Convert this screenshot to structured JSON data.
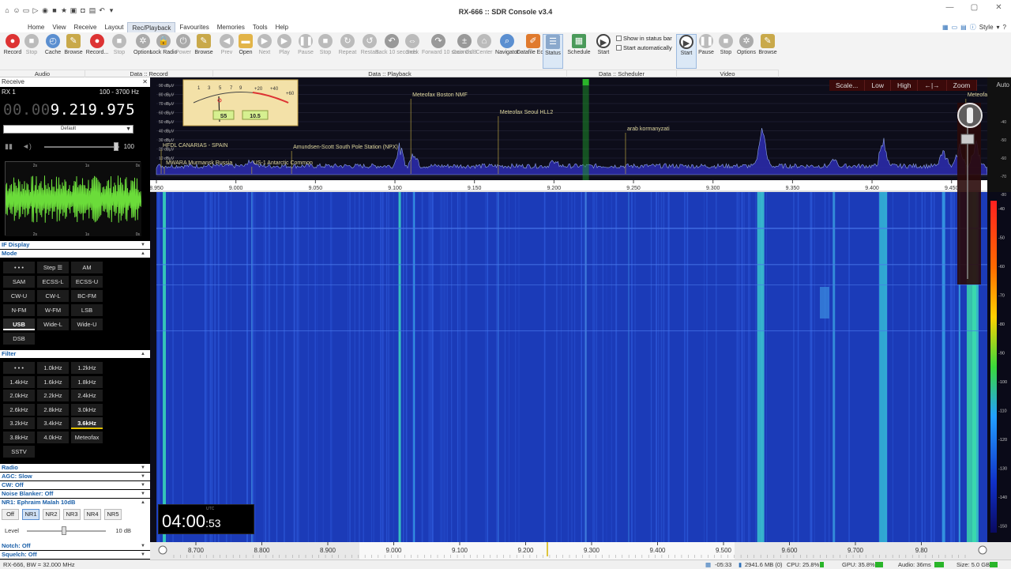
{
  "window": {
    "title": "RX-666 :: SDR Console v3.4"
  },
  "menu": {
    "items": [
      "Home",
      "View",
      "Receive",
      "Layout",
      "Rec/Playback",
      "Favourites",
      "Memories",
      "Tools",
      "Help"
    ],
    "active": "Rec/Playback",
    "style_label": "Style"
  },
  "ribbon": {
    "buttons": [
      {
        "label": "Record",
        "icon": "record-icon"
      },
      {
        "label": "Stop",
        "icon": "stop-icon"
      },
      {
        "label": "Cache",
        "icon": "cache-icon"
      },
      {
        "label": "Browse",
        "icon": "browse-icon"
      },
      {
        "label": "Record...",
        "icon": "record-icon"
      },
      {
        "label": "Stop",
        "icon": "stop-icon"
      },
      {
        "label": "Options",
        "icon": "gear-icon"
      },
      {
        "label": "Lock Radio",
        "icon": "lock-icon"
      },
      {
        "label": "Power",
        "icon": "power-icon"
      },
      {
        "label": "Browse",
        "icon": "browse-icon"
      },
      {
        "label": "Prev",
        "icon": "prev-icon"
      },
      {
        "label": "Open",
        "icon": "folder-icon"
      },
      {
        "label": "Next",
        "icon": "next-icon"
      },
      {
        "label": "Play",
        "icon": "play-icon"
      },
      {
        "label": "Pause",
        "icon": "pause-icon"
      },
      {
        "label": "Stop",
        "icon": "stop-icon"
      },
      {
        "label": "Repeat",
        "icon": "repeat-icon"
      },
      {
        "label": "Restart",
        "icon": "restart-icon"
      },
      {
        "label": "Back 10 seconds",
        "icon": "back-icon"
      },
      {
        "label": "Seek",
        "icon": "seek-icon"
      },
      {
        "label": "Forward 10 seconds",
        "icon": "forward-icon"
      },
      {
        "label": "Gain 0 dB",
        "icon": "gain-icon"
      },
      {
        "label": "Center",
        "icon": "center-icon"
      },
      {
        "label": "Navigator",
        "icon": "navigator-icon"
      },
      {
        "label": "Datafile Editor",
        "icon": "editor-icon"
      },
      {
        "label": "Status",
        "icon": "status-icon"
      },
      {
        "label": "Schedule",
        "icon": "schedule-icon"
      },
      {
        "label": "Start",
        "icon": "start-icon"
      },
      {
        "label": "Start",
        "icon": "start-icon"
      },
      {
        "label": "Pause",
        "icon": "pause-icon"
      },
      {
        "label": "Stop",
        "icon": "stop-icon"
      },
      {
        "label": "Options",
        "icon": "gear-icon"
      },
      {
        "label": "Browse",
        "icon": "browse-icon"
      }
    ],
    "groups": [
      "Audio",
      "Data :: Record",
      "Data :: Playback",
      "Data :: Scheduler",
      "Video"
    ],
    "show_in_status_bar": "Show in status bar",
    "start_automatically": "Start automatically"
  },
  "receive_panel": {
    "header": "Receive",
    "rx": "RX 1",
    "range": "100 - 3700 Hz",
    "freq_dim": "00.00",
    "freq_main": "9.219.975",
    "dropdown": "Default",
    "volume": "100",
    "sections": {
      "if_display": "IF Display",
      "mode": "Mode",
      "filter": "Filter",
      "radio": "Radio",
      "agc": "AGC: Slow",
      "cw": "CW: Off",
      "noise_blanker": "Noise Blanker: Off",
      "nr1": "NR1: Ephraim Malah 10dB",
      "level": "Level",
      "level_value": "10 dB",
      "notch": "Notch: Off",
      "squelch": "Squelch: Off"
    },
    "modes": [
      "• • •",
      "Step ☰",
      "AM",
      "SAM",
      "ECSS-L",
      "ECSS-U",
      "CW-U",
      "CW-L",
      "BC-FM",
      "N-FM",
      "W-FM",
      "LSB",
      "USB",
      "Wide-L",
      "Wide-U",
      "DSB"
    ],
    "filters": [
      "• • •",
      "1.0kHz",
      "1.2kHz",
      "1.4kHz",
      "1.6kHz",
      "1.8kHz",
      "2.0kHz",
      "2.2kHz",
      "2.4kHz",
      "2.6kHz",
      "2.8kHz",
      "3.0kHz",
      "3.2kHz",
      "3.4kHz",
      "3.6kHz",
      "3.8kHz",
      "4.0kHz",
      "Meteofax",
      "SSTV"
    ],
    "nr_buttons": [
      "Off",
      "NR1",
      "NR2",
      "NR3",
      "NR4",
      "NR5"
    ],
    "scope_ticks": [
      "2s",
      "1s",
      "0s"
    ]
  },
  "spectrum": {
    "top_buttons": [
      "Scale...",
      "Low",
      "High",
      "←|→",
      "Zoom"
    ],
    "auto": "Auto",
    "db_scale": [
      "90 dBµV",
      "80 dBµV",
      "70 dBµV",
      "60 dBµV",
      "50 dBµV",
      "40 dBµV",
      "30 dBµV",
      "20 dBµV",
      "10 dBµV"
    ],
    "freq_ticks": [
      "8.950",
      "9.000",
      "9.050",
      "9.100",
      "9.150",
      "9.200",
      "9.250",
      "9.300",
      "9.350",
      "9.400",
      "9.450"
    ],
    "bottom_ticks": [
      "8.700",
      "8.800",
      "8.900",
      "9.000",
      "9.100",
      "9.200",
      "9.300",
      "9.400",
      "9.500",
      "9.600",
      "9.700",
      "9.80"
    ],
    "labels": [
      {
        "text": "Meteofax Boston NMF",
        "freq": 9.11
      },
      {
        "text": "Meteofax Seoul HLL2",
        "freq": 9.165
      },
      {
        "text": "arab kormanyzati",
        "freq": 9.245
      },
      {
        "text": "HFDL CANARIAS - SPAIN",
        "freq": 8.953
      },
      {
        "text": "Amundsen-Scott South Pole Station (NPX)",
        "freq": 9.035
      },
      {
        "text": "MWARA Murmansk Russia",
        "freq": 8.955
      },
      {
        "text": "US-1 Antarctic Common",
        "freq": 9.01
      },
      {
        "text": "Meteofax Wellington",
        "freq": 9.459
      }
    ],
    "right_scale": [
      "-40",
      "-50",
      "-60",
      "-70",
      "-80",
      "-90",
      "-100",
      "-110",
      "-120",
      "-130",
      "-140",
      "-150"
    ],
    "meter_s": "S5",
    "meter_val": "10.5",
    "clock_utc": "UTC",
    "clock_hm": "04:00",
    "clock_s": ":53"
  },
  "status": {
    "left": "RX-666, BW = 32.000 MHz",
    "time": "-05:33",
    "mem": "2941.6 MB (0)",
    "cpu": "CPU: 25.8%",
    "gpu": "GPU: 35.8%",
    "audio": "Audio: 36ms",
    "size": "Size: 5.0 GB"
  }
}
